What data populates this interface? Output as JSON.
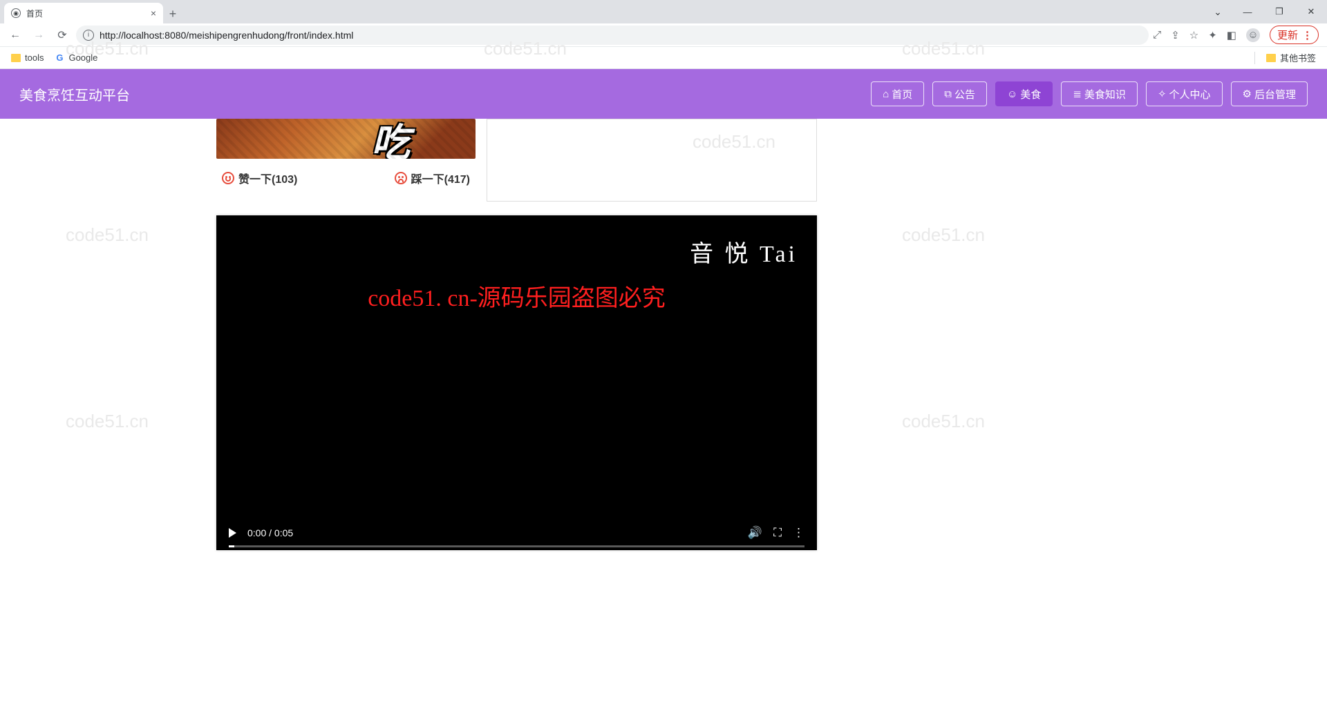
{
  "browser": {
    "tab_title": "首页",
    "url_display": "http://localhost:8080/meishipengrenhudong/front/index.html",
    "update_label": "更新",
    "bookmarks": {
      "tools": "tools",
      "google": "Google",
      "other": "其他书签"
    },
    "win": {
      "chev": "⌄",
      "min": "—",
      "max": "❐",
      "close": "✕"
    }
  },
  "nav": {
    "brand": "美食烹饪互动平台",
    "items": [
      {
        "icon": "⌂",
        "label": "首页",
        "active": false
      },
      {
        "icon": "⧉",
        "label": "公告",
        "active": false
      },
      {
        "icon": "☺",
        "label": "美食",
        "active": true
      },
      {
        "icon": "≣",
        "label": "美食知识",
        "active": false
      },
      {
        "icon": "✧",
        "label": "个人中心",
        "active": false
      },
      {
        "icon": "⚙",
        "label": "后台管理",
        "active": false
      }
    ]
  },
  "card": {
    "img_text": "吃",
    "like_label": "赞一下(103)",
    "dislike_label": "踩一下(417)"
  },
  "video": {
    "logo": "音 悦 Tai",
    "center_watermark": "code51. cn-源码乐园盗图必究",
    "time": "0:00 / 0:05"
  },
  "watermarks": {
    "w1": "code51.cn",
    "w2": "code51.cn",
    "w3": "code51.cn",
    "w4": "code51.cn",
    "w5": "code51.cn",
    "w6": "code51.cn",
    "w7": "code51.cn",
    "w8": "code51.cn"
  }
}
